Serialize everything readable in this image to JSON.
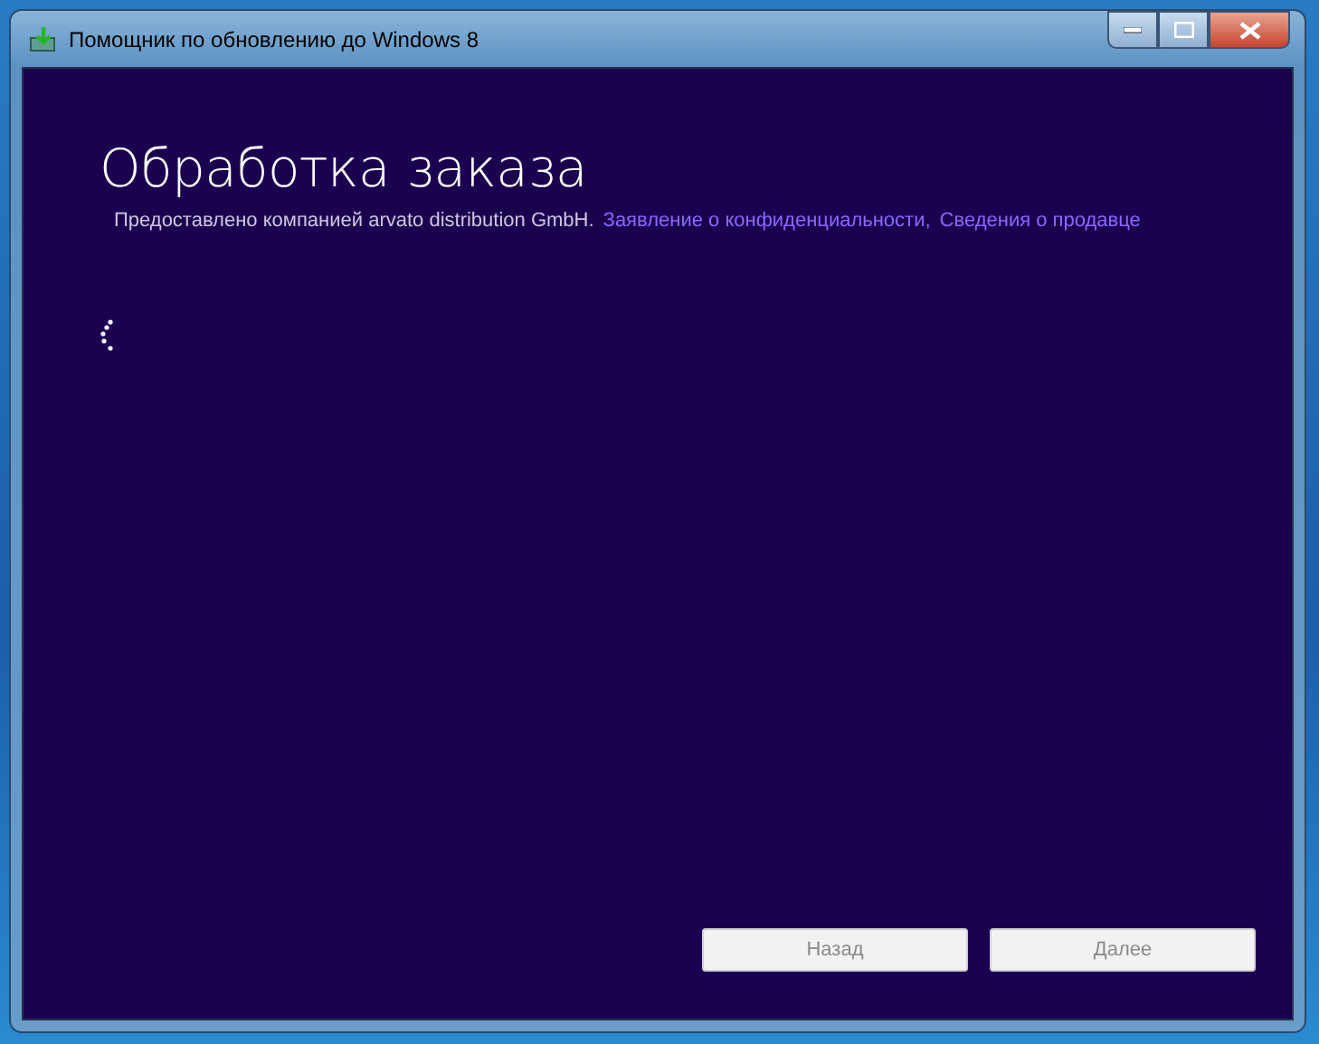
{
  "window": {
    "title": "Помощник по обновлению до Windows 8"
  },
  "heading": "Обработка заказа",
  "provider": {
    "text": "Предоставлено компанией arvato distribution GmbH.",
    "links": [
      "Заявление о конфиденциальности,",
      "Сведения о продавце"
    ]
  },
  "buttons": [
    {
      "label": "Назад",
      "disabled": true
    },
    {
      "label": "Далее",
      "disabled": true
    }
  ]
}
